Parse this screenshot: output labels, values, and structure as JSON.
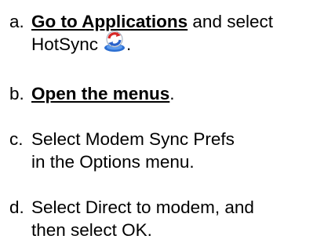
{
  "steps": [
    {
      "marker": "a.",
      "link": "Go to Applications",
      "text_after_link": " and select",
      "text_line2": "HotSync",
      "icon": "hotsync-icon",
      "trail": "."
    },
    {
      "marker": "b.",
      "link": "Open the menus",
      "trail": "."
    },
    {
      "marker": "c.",
      "text": "Select Modem Sync Prefs in the Options menu."
    },
    {
      "marker": "d.",
      "text": "Select Direct to modem, and then select OK."
    }
  ]
}
